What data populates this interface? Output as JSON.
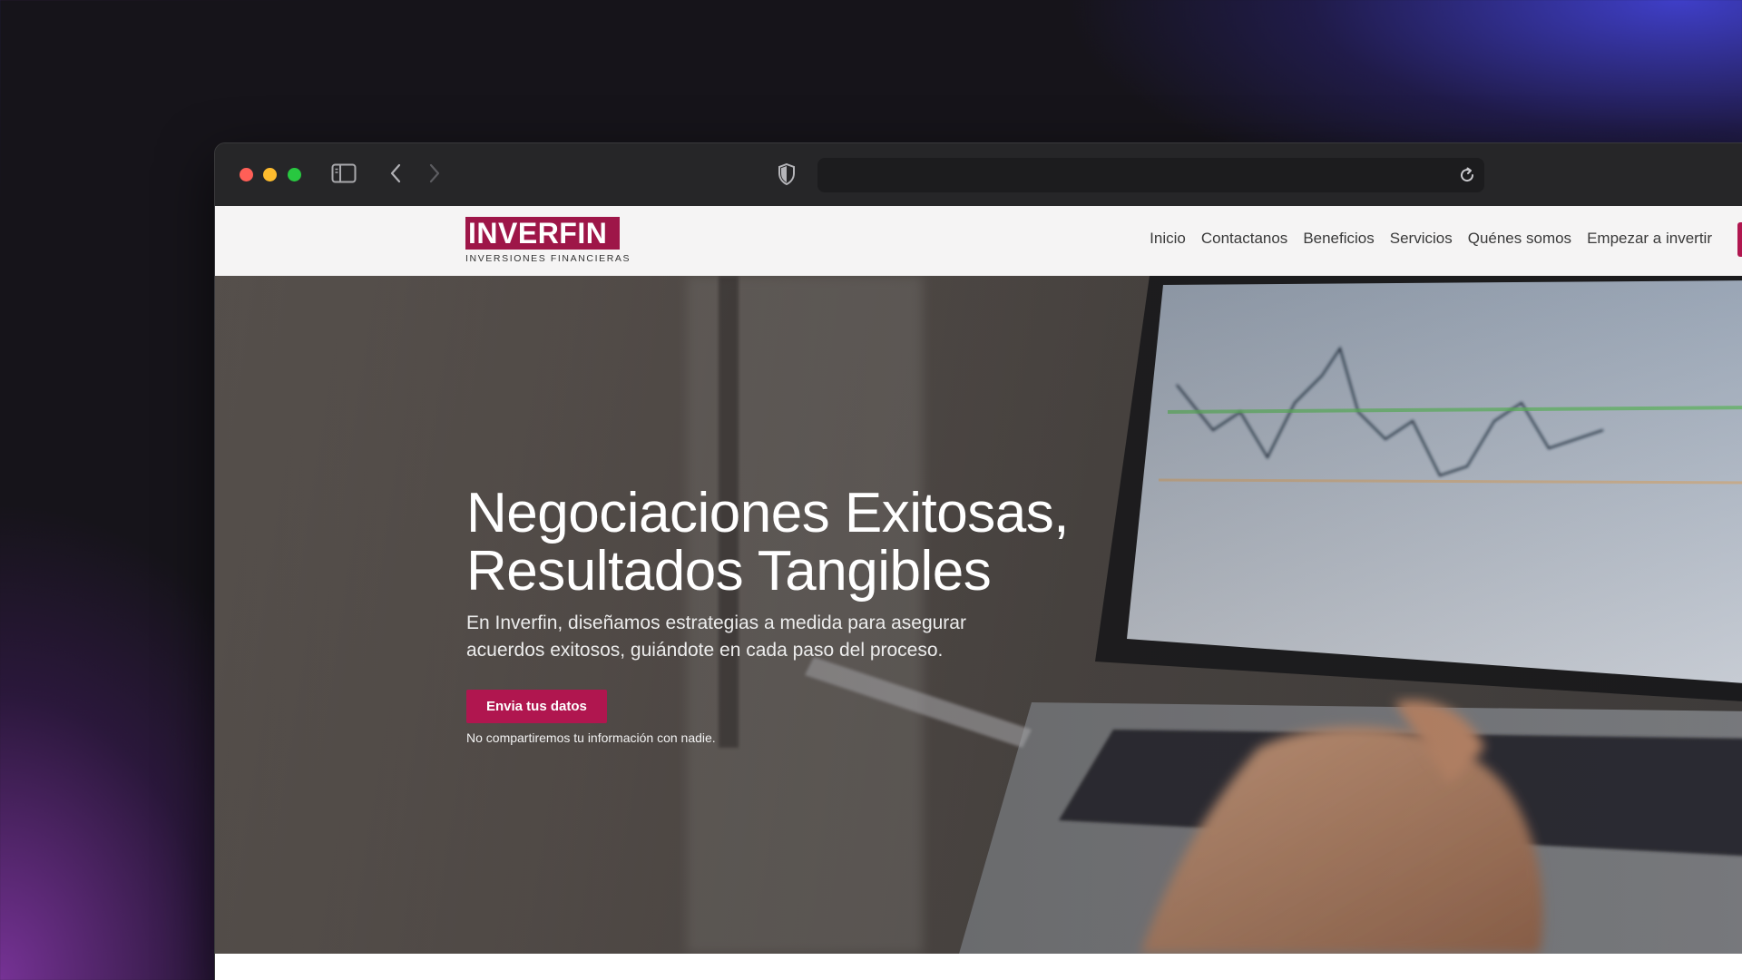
{
  "browser": {
    "address": ""
  },
  "logo": {
    "name": "INVERFIN",
    "tagline": "INVERSIONES FINANCIERAS",
    "color": "#9e1648"
  },
  "nav": {
    "items": [
      {
        "label": "Inicio"
      },
      {
        "label": "Contactanos"
      },
      {
        "label": "Beneficios"
      },
      {
        "label": "Servicios"
      },
      {
        "label": "Quénes somos"
      },
      {
        "label": "Empezar a invertir"
      }
    ]
  },
  "hero": {
    "title_line1": "Negociaciones Exitosas,",
    "title_line2": "Resultados Tangibles",
    "description": "En Inverfin, diseñamos estrategias a medida para asegurar acuerdos exitosos, guiándote en cada paso del proceso.",
    "button_label": "Envia tus datos",
    "note": "No compartiremos tu información con nadie."
  },
  "colors": {
    "accent": "#b0164f",
    "red": "#ff5f57",
    "yellow": "#febc2e",
    "green": "#28c840"
  }
}
